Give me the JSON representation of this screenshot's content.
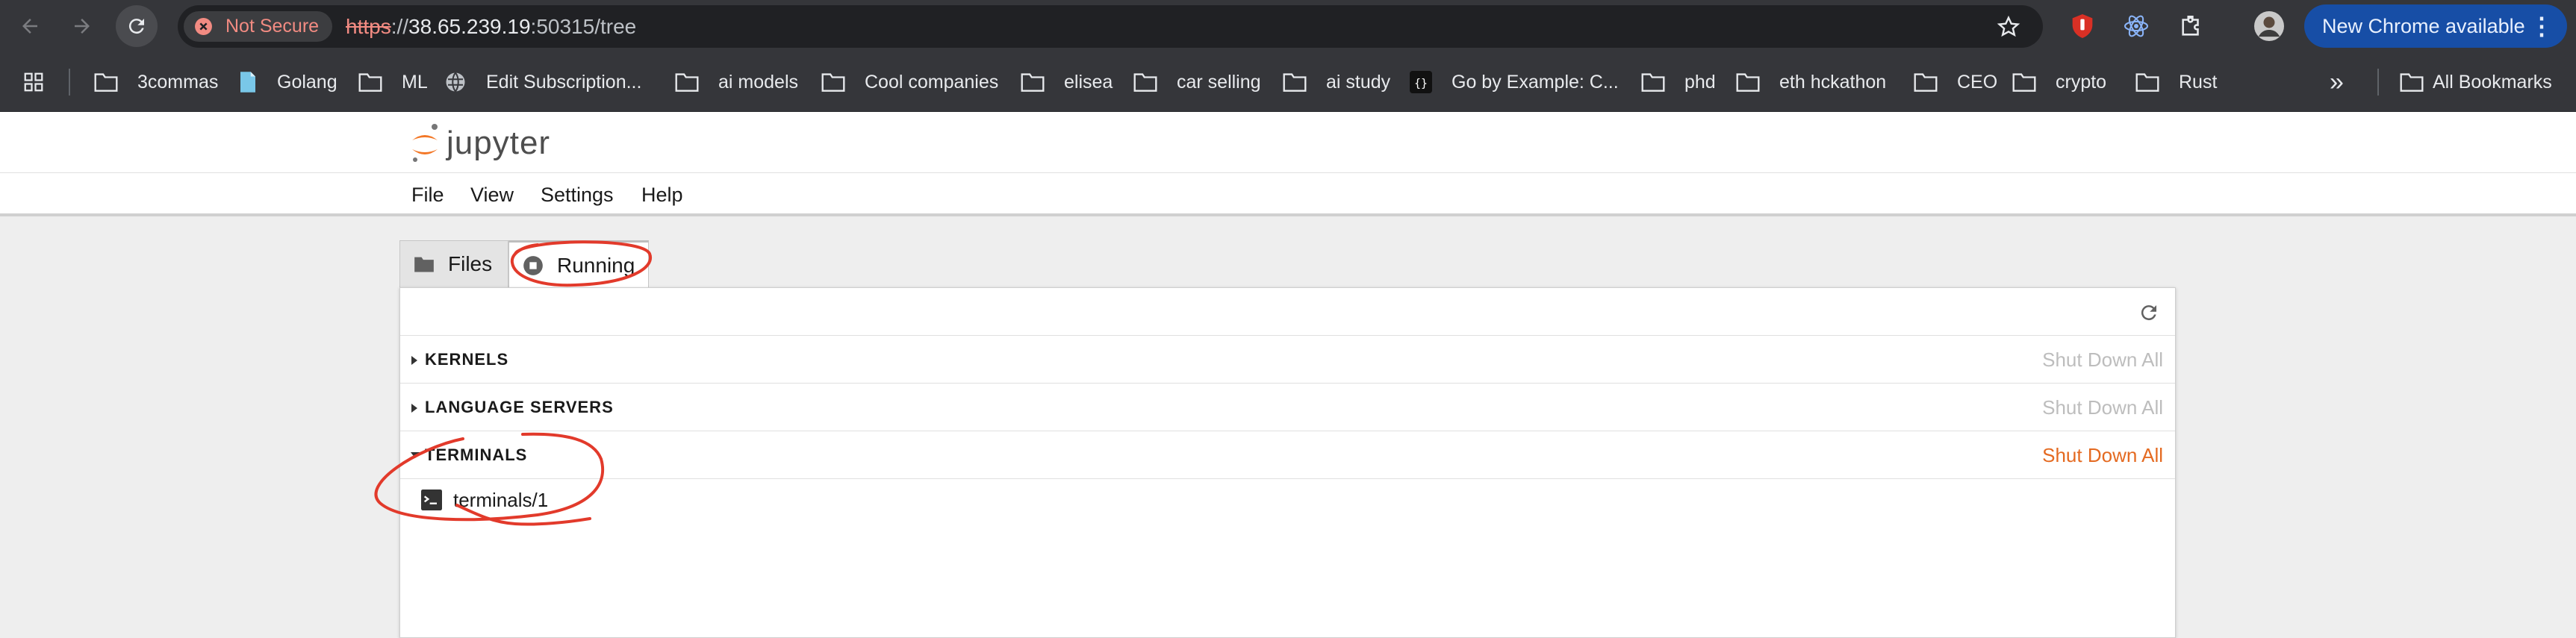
{
  "browser": {
    "not_secure_label": "Not Secure",
    "url_scheme": "https",
    "url_sep": "://",
    "url_host": "38.65.239.19",
    "url_rest": ":50315/tree",
    "update_label": "New Chrome available",
    "menu_dots": "⋮"
  },
  "bookmarks": {
    "items": [
      {
        "label": "3commas",
        "icon": "folder-icon"
      },
      {
        "label": "Golang",
        "icon": "page-icon"
      },
      {
        "label": "ML",
        "icon": "folder-icon"
      },
      {
        "label": "Edit Subscription...",
        "icon": "globe-icon"
      },
      {
        "label": "ai models",
        "icon": "folder-icon"
      },
      {
        "label": "Cool companies",
        "icon": "folder-icon"
      },
      {
        "label": "elisea",
        "icon": "folder-icon"
      },
      {
        "label": "car selling",
        "icon": "folder-icon"
      },
      {
        "label": "ai study",
        "icon": "folder-icon"
      },
      {
        "label": "Go by Example: C...",
        "icon": "code-icon"
      },
      {
        "label": "phd",
        "icon": "folder-icon"
      },
      {
        "label": "eth hckathon",
        "icon": "folder-icon"
      },
      {
        "label": "CEO",
        "icon": "folder-icon"
      },
      {
        "label": "crypto",
        "icon": "folder-icon"
      },
      {
        "label": "Rust",
        "icon": "folder-icon"
      }
    ],
    "overflow": "»",
    "all_bookmarks": "All Bookmarks"
  },
  "jupyter": {
    "logo_text": "jupyter",
    "menu": [
      "File",
      "View",
      "Settings",
      "Help"
    ],
    "tabs": {
      "files": "Files",
      "running": "Running"
    },
    "sections": [
      {
        "title": "KERNELS",
        "action": "Shut Down All",
        "expanded": false
      },
      {
        "title": "LANGUAGE SERVERS",
        "action": "Shut Down All",
        "expanded": false
      },
      {
        "title": "TERMINALS",
        "action": "Shut Down All",
        "expanded": true
      }
    ],
    "terminal_item": "terminals/1",
    "terminal_icon_text": "$_"
  },
  "colors": {
    "accent_orange": "#e46a21",
    "annotation_red": "#e23a2b",
    "chrome_dark": "#35363a"
  }
}
